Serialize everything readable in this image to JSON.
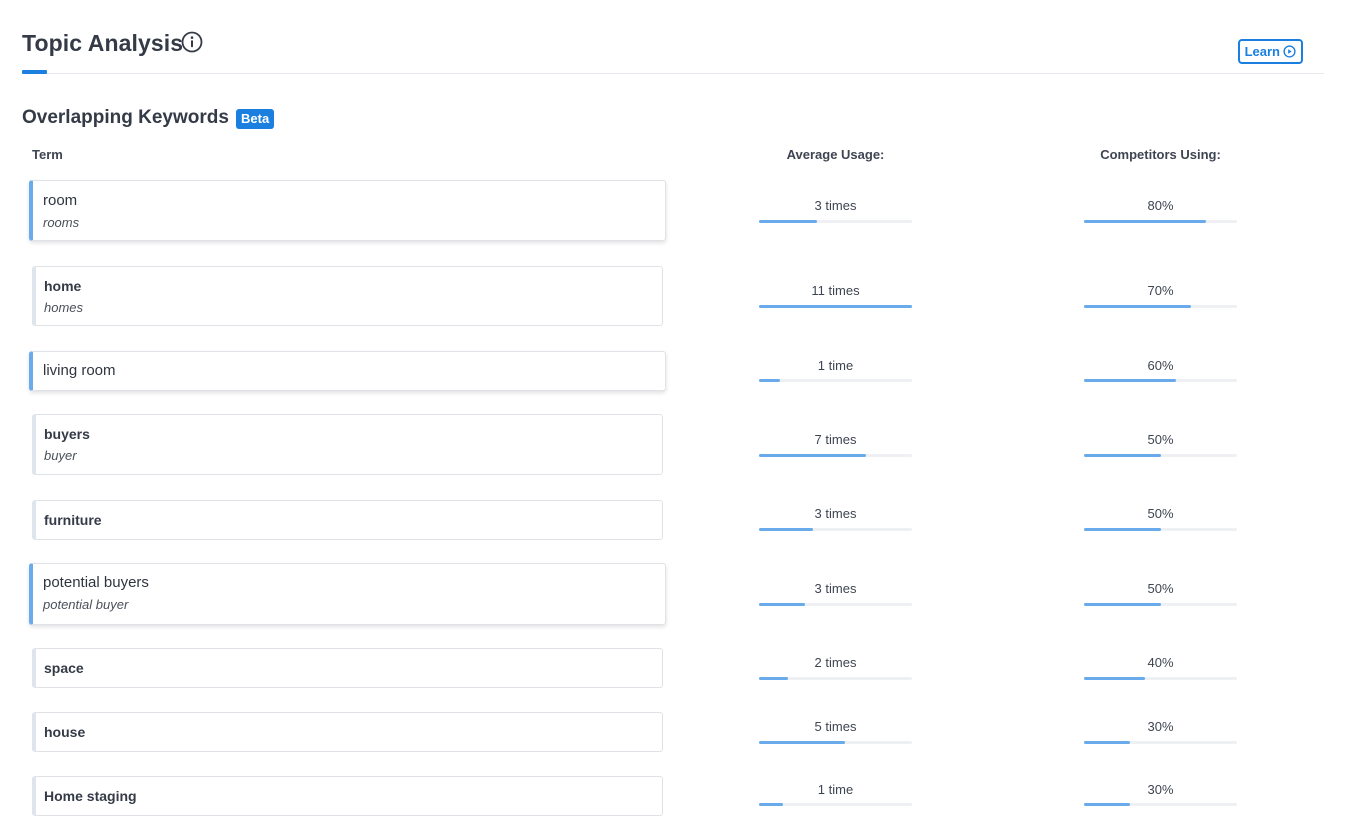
{
  "header": {
    "title": "Topic Analysis",
    "learn_label": "Learn"
  },
  "section": {
    "title": "Overlapping Keywords",
    "badge": "Beta"
  },
  "columns": {
    "term": "Term",
    "average_usage": "Average Usage:",
    "competitors_using": "Competitors Using:"
  },
  "colors": {
    "accent": "#1b7fe0",
    "bar": "#68aaea",
    "bar_track": "#eef0f3"
  },
  "keywords": [
    {
      "term": "room",
      "variant": "rooms",
      "usage": "3 times",
      "usage_level": 0.38,
      "competitors": "80%",
      "competitors_level": 0.8,
      "active": true
    },
    {
      "term": "home",
      "variant": "homes",
      "usage": "11 times",
      "usage_level": 1.0,
      "competitors": "70%",
      "competitors_level": 0.7,
      "active": false
    },
    {
      "term": "living room",
      "variant": "",
      "usage": "1 time",
      "usage_level": 0.14,
      "competitors": "60%",
      "competitors_level": 0.6,
      "active": true
    },
    {
      "term": "buyers",
      "variant": "buyer",
      "usage": "7 times",
      "usage_level": 0.7,
      "competitors": "50%",
      "competitors_level": 0.5,
      "active": false
    },
    {
      "term": "furniture",
      "variant": "",
      "usage": "3 times",
      "usage_level": 0.35,
      "competitors": "50%",
      "competitors_level": 0.5,
      "active": false
    },
    {
      "term": "potential buyers",
      "variant": "potential buyer",
      "usage": "3 times",
      "usage_level": 0.3,
      "competitors": "50%",
      "competitors_level": 0.5,
      "active": true
    },
    {
      "term": "space",
      "variant": "",
      "usage": "2 times",
      "usage_level": 0.19,
      "competitors": "40%",
      "competitors_level": 0.4,
      "active": false
    },
    {
      "term": "house",
      "variant": "",
      "usage": "5 times",
      "usage_level": 0.56,
      "competitors": "30%",
      "competitors_level": 0.3,
      "active": false
    },
    {
      "term": "Home staging",
      "variant": "",
      "usage": "1 time",
      "usage_level": 0.16,
      "competitors": "30%",
      "competitors_level": 0.3,
      "active": false
    }
  ]
}
